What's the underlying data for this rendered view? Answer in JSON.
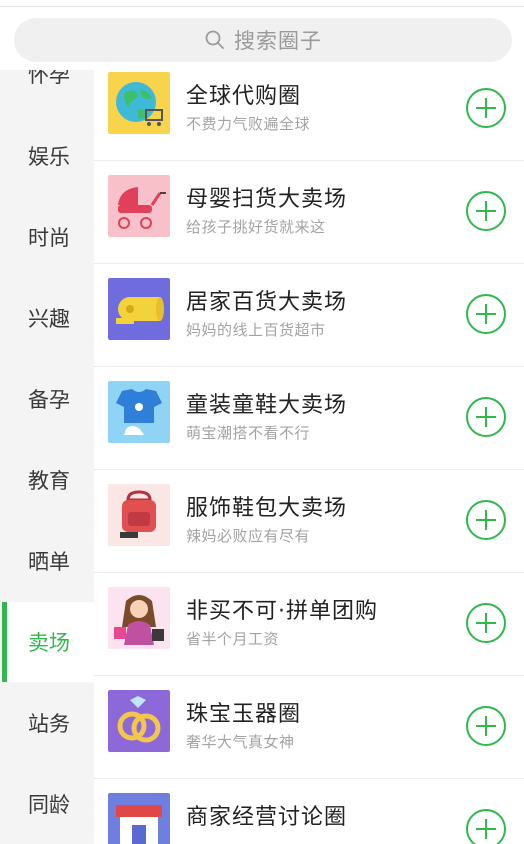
{
  "search": {
    "placeholder": "搜索圈子",
    "icon": "search-icon"
  },
  "sidebar": {
    "items": [
      {
        "label": "怀孕",
        "active": false
      },
      {
        "label": "娱乐",
        "active": false
      },
      {
        "label": "时尚",
        "active": false
      },
      {
        "label": "兴趣",
        "active": false
      },
      {
        "label": "备孕",
        "active": false
      },
      {
        "label": "教育",
        "active": false
      },
      {
        "label": "晒单",
        "active": false
      },
      {
        "label": "卖场",
        "active": true
      },
      {
        "label": "站务",
        "active": false
      },
      {
        "label": "同龄",
        "active": false
      }
    ]
  },
  "circles": [
    {
      "title": "全球代购圈",
      "subtitle": "不费力气败遍全球",
      "icon": "globe-cart-icon"
    },
    {
      "title": "母婴扫货大卖场",
      "subtitle": "给孩子挑好货就来这",
      "icon": "baby-stroller-icon"
    },
    {
      "title": "居家百货大卖场",
      "subtitle": "妈妈的线上百货超市",
      "icon": "tissue-roll-icon"
    },
    {
      "title": "童装童鞋大卖场",
      "subtitle": "萌宝潮搭不看不行",
      "icon": "baby-clothes-icon"
    },
    {
      "title": "服饰鞋包大卖场",
      "subtitle": "辣妈必败应有尽有",
      "icon": "backpack-icon"
    },
    {
      "title": "非买不可·拼单团购",
      "subtitle": "省半个月工资",
      "icon": "shopping-woman-icon"
    },
    {
      "title": "珠宝玉器圈",
      "subtitle": "奢华大气真女神",
      "icon": "rings-icon"
    },
    {
      "title": "商家经营讨论圈",
      "subtitle": "",
      "icon": "storefront-icon"
    }
  ],
  "colors": {
    "accent": "#2fb84c",
    "sidebar_bg": "#f4f4f4",
    "search_bg": "#f0f0f0"
  }
}
